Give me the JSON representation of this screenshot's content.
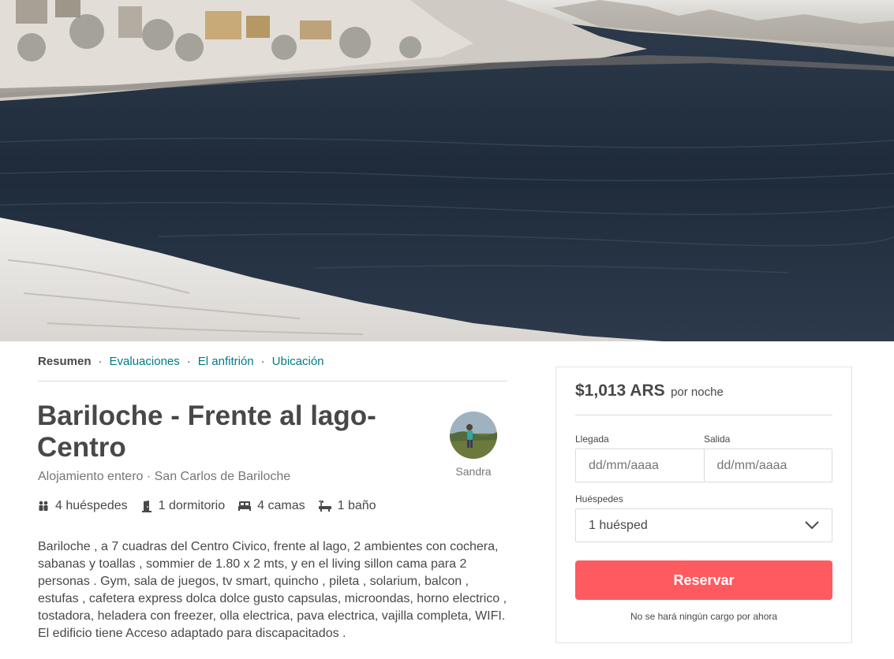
{
  "listing_nav": {
    "items": [
      "Resumen",
      "Evaluaciones",
      "El anfitrión",
      "Ubicación"
    ],
    "separator": "·",
    "active": "Resumen"
  },
  "listing": {
    "title": "Bariloche - Frente al lago- Centro",
    "location": "Alojamiento entero · San Carlos de Bariloche",
    "host_name": "Sandra",
    "amenities": [
      {
        "icon": "guests-icon",
        "label": "4 huéspedes"
      },
      {
        "icon": "door-icon",
        "label": "1 dormitorio"
      },
      {
        "icon": "bed-icon",
        "label": "4 camas"
      },
      {
        "icon": "bathtub-icon",
        "label": "1 baño"
      }
    ],
    "description": "Bariloche , a 7 cuadras del Centro Civico, frente al lago, 2 ambientes con cochera, sabanas y toallas , sommier de 1.80 x 2 mts, y en el living sillon cama para 2 personas . Gym, sala de juegos, tv smart, quincho , pileta , solarium, balcon , estufas , cafetera express dolca dolce gusto capsulas, microondas, horno electrico , tostadora, heladera con freezer, olla electrica, pava electrica, vajilla completa, WIFI. El edificio tiene Acceso adaptado para discapacitados ."
  },
  "booking": {
    "price": "$1,013 ARS",
    "per_night": "por noche",
    "checkin_label": "Llegada",
    "checkout_label": "Salida",
    "checkin_placeholder": "dd/mm/aaaa",
    "checkout_placeholder": "dd/mm/aaaa",
    "guests_label": "Huéspedes",
    "guests_value": "1 huésped",
    "reserve_label": "Reservar",
    "note": "No se hará ningún cargo por ahora"
  },
  "colors": {
    "accent": "#ff5a5f",
    "link": "#007a87",
    "text": "#484848",
    "muted": "#767676"
  }
}
